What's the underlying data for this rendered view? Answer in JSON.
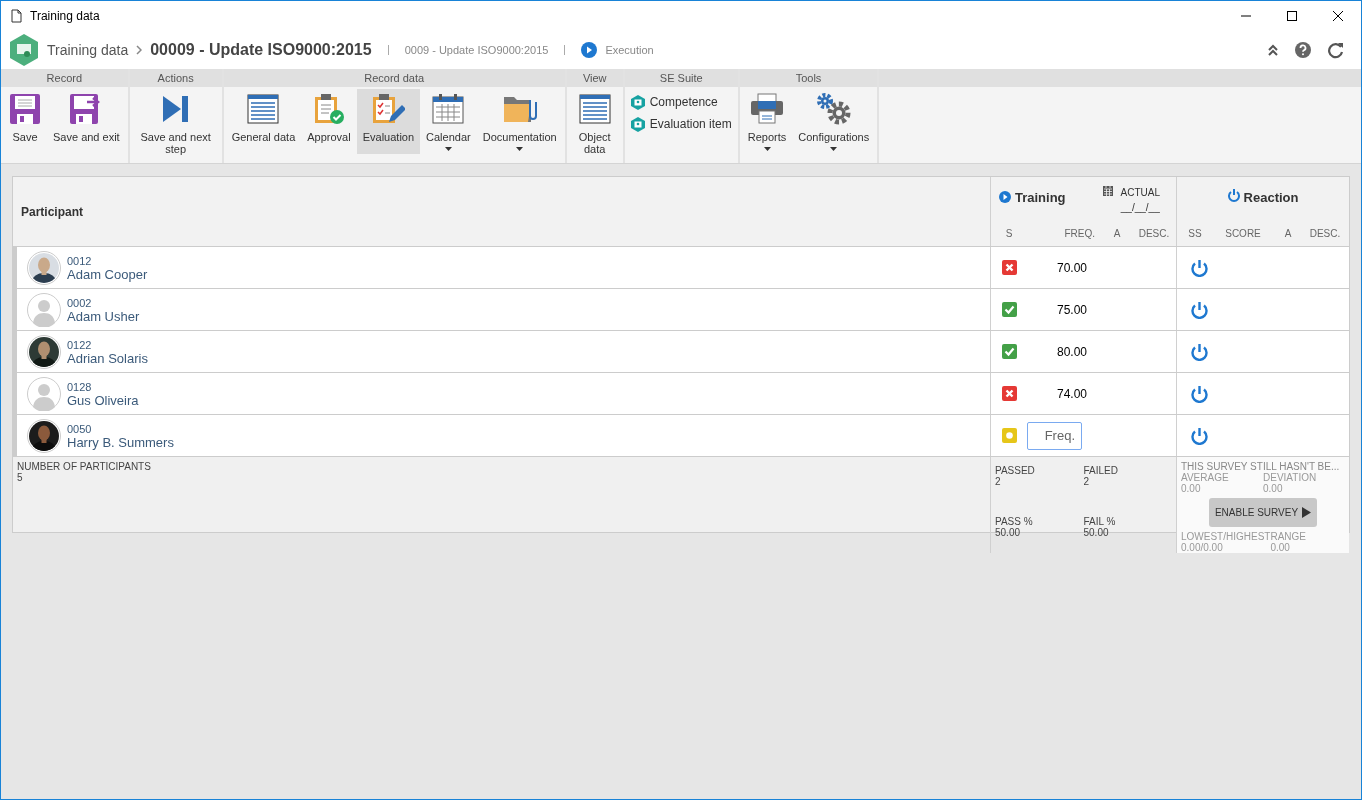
{
  "window": {
    "title": "Training data"
  },
  "header": {
    "breadcrumb": "Training data",
    "title": "00009 - Update ISO9000:2015",
    "subtitle": "0009 - Update ISO9000:2015",
    "status": "Execution"
  },
  "ribbon": {
    "groups": [
      {
        "label": "Record",
        "items": [
          {
            "label": "Save",
            "kind": "large",
            "selected": false,
            "dropdown": false
          },
          {
            "label": "Save and exit",
            "kind": "large",
            "selected": false,
            "dropdown": false
          }
        ]
      },
      {
        "label": "Actions",
        "items": [
          {
            "label": "Save and next step",
            "kind": "large",
            "selected": false,
            "dropdown": false
          }
        ]
      },
      {
        "label": "Record data",
        "items": [
          {
            "label": "General data",
            "kind": "large",
            "selected": false,
            "dropdown": false
          },
          {
            "label": "Approval",
            "kind": "large",
            "selected": false,
            "dropdown": false
          },
          {
            "label": "Evaluation",
            "kind": "large",
            "selected": true,
            "dropdown": false
          },
          {
            "label": "Calendar",
            "kind": "large",
            "selected": false,
            "dropdown": true
          },
          {
            "label": "Documentation",
            "kind": "large",
            "selected": false,
            "dropdown": true
          }
        ]
      },
      {
        "label": "View",
        "items": [
          {
            "label": "Object data",
            "kind": "large",
            "selected": false,
            "dropdown": false
          }
        ]
      },
      {
        "label": "SE Suite",
        "items": [
          {
            "label": "Competence",
            "kind": "small",
            "selected": false,
            "dropdown": false
          },
          {
            "label": "Evaluation item",
            "kind": "small",
            "selected": false,
            "dropdown": false
          }
        ]
      },
      {
        "label": "Tools",
        "items": [
          {
            "label": "Reports",
            "kind": "large",
            "selected": false,
            "dropdown": true
          },
          {
            "label": "Configurations",
            "kind": "large",
            "selected": false,
            "dropdown": true
          }
        ]
      }
    ]
  },
  "table": {
    "participant_header": "Participant",
    "training": {
      "title": "Training",
      "date_label": "ACTUAL",
      "date_value": "__/__/__",
      "columns": [
        "S",
        "FREQ.",
        "A",
        "DESC."
      ]
    },
    "reaction": {
      "title": "Reaction",
      "columns": [
        "SS",
        "SCORE",
        "A",
        "DESC."
      ]
    },
    "rows": [
      {
        "code": "0012",
        "name": "Adam Cooper",
        "status": {
          "kind": "failed"
        },
        "frequency": "70.00"
      },
      {
        "code": "0002",
        "name": "Adam Usher",
        "avatar": {
          "kind": "placeholder"
        },
        "status": {
          "kind": "passed"
        },
        "frequency": "75.00"
      },
      {
        "code": "0122",
        "name": "Adrian Solaris",
        "status": {
          "kind": "passed"
        },
        "frequency": "80.00"
      },
      {
        "code": "0128",
        "name": "Gus Oliveira",
        "avatar": {
          "kind": "placeholder"
        },
        "status": {
          "kind": "failed"
        },
        "frequency": "74.00"
      },
      {
        "code": "0050",
        "name": "Harry B. Summers",
        "status": {
          "kind": "pending"
        },
        "placeholder": "Freq."
      }
    ],
    "footer": {
      "participants_label": "NUMBER OF PARTICIPANTS",
      "participants_count": "5",
      "training_stats": [
        {
          "label": "PASSED",
          "value": "2"
        },
        {
          "label": "FAILED",
          "value": "2"
        },
        {
          "label": "PASS %",
          "value": "50.00"
        },
        {
          "label": "FAIL %",
          "value": "50.00"
        }
      ],
      "reaction_message": "THIS SURVEY STILL HASN'T BE...",
      "reaction_stats": [
        {
          "label": "AVERAGE",
          "value": "0.00"
        },
        {
          "label": "DEVIATION",
          "value": "0.00"
        },
        {
          "label": "LOWEST/HIGHEST",
          "value": "0.00/0.00"
        },
        {
          "label": "RANGE",
          "value": "0.00"
        }
      ],
      "survey_button": "ENABLE SURVEY"
    }
  }
}
